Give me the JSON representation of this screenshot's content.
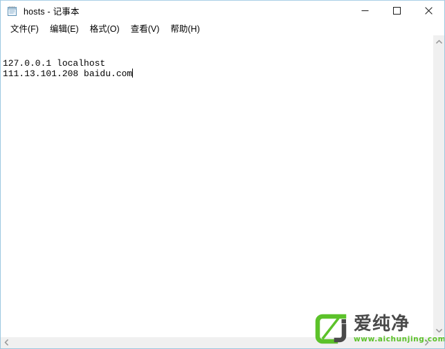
{
  "window": {
    "title": "hosts - 记事本",
    "app_icon": "notepad-icon",
    "border_color": "#9cc7e0",
    "controls": [
      {
        "name": "minimize-button",
        "label": "—",
        "icon": "minimize-icon"
      },
      {
        "name": "maximize-button",
        "label": "□",
        "icon": "maximize-icon"
      },
      {
        "name": "close-button",
        "label": "✕",
        "icon": "close-icon"
      }
    ]
  },
  "menubar": {
    "items": [
      {
        "label": "文件(F)",
        "name": "menu-file"
      },
      {
        "label": "编辑(E)",
        "name": "menu-edit"
      },
      {
        "label": "格式(O)",
        "name": "menu-format"
      },
      {
        "label": "查看(V)",
        "name": "menu-view"
      },
      {
        "label": "帮助(H)",
        "name": "menu-help"
      }
    ]
  },
  "editor": {
    "lines": [
      "127.0.0.1 localhost",
      "111.13.101.208 baidu.com"
    ],
    "line1": "127.0.0.1 localhost",
    "line2": "111.13.101.208 baidu.com",
    "caret_line": 2,
    "caret_visible": true,
    "text_color": "#000000",
    "background": "#ffffff"
  },
  "scrollbars": {
    "vertical": {
      "up_arrow": "chevron-up-icon",
      "down_arrow": "chevron-down-icon",
      "track_color": "#f0f0f0"
    },
    "horizontal": {
      "left_arrow": "chevron-left-icon",
      "right_arrow": "chevron-right-icon",
      "track_color": "#f0f0f0"
    }
  },
  "watermark": {
    "brand_cn": "爱纯净",
    "url": "www.aichunjing.com",
    "mark_color": "#5cc22a",
    "accent_dark": "#4a4a4a"
  }
}
